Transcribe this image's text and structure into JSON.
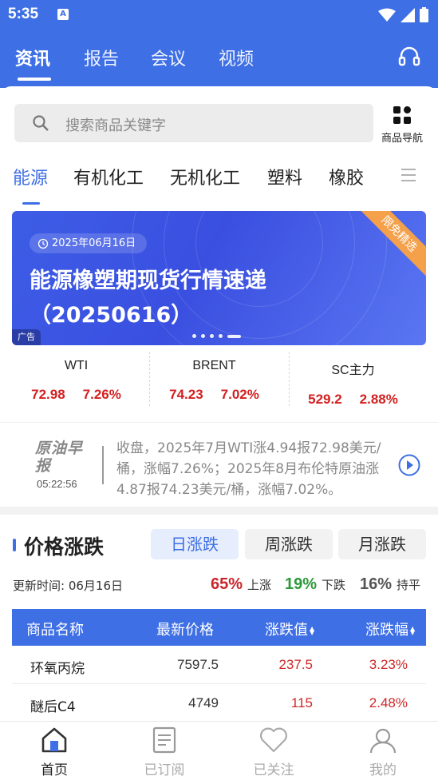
{
  "status_bar": {
    "time": "5:35"
  },
  "top_tabs": [
    {
      "label": "资讯",
      "active": true
    },
    {
      "label": "报告",
      "active": false
    },
    {
      "label": "会议",
      "active": false
    },
    {
      "label": "视频",
      "active": false
    }
  ],
  "search": {
    "placeholder": "搜索商品关键字",
    "goods_nav_label": "商品导航"
  },
  "category_tabs": [
    {
      "label": "能源",
      "active": true
    },
    {
      "label": "有机化工",
      "active": false
    },
    {
      "label": "无机化工",
      "active": false
    },
    {
      "label": "塑料",
      "active": false
    },
    {
      "label": "橡胶",
      "active": false
    }
  ],
  "banner": {
    "date": "2025年06月16日",
    "title": "能源橡塑期现货行情速递（20250616）",
    "ribbon": "限免精选",
    "ad_label": "广告",
    "dot_count": 5,
    "active_dot": 4
  },
  "quotes": [
    {
      "name": "WTI",
      "price": "72.98",
      "change": "7.26%"
    },
    {
      "name": "BRENT",
      "price": "74.23",
      "change": "7.02%"
    },
    {
      "name": "SC主力",
      "price": "529.2",
      "change": "2.88%"
    }
  ],
  "morning_report": {
    "logo": "原油早报",
    "time": "05:22:56",
    "text": "收盘，2025年7月WTI涨4.94报72.98美元/桶，涨幅7.26%；2025年8月布伦特原油涨4.87报74.23美元/桶，涨幅7.02%。"
  },
  "price_section": {
    "title": "价格涨跌",
    "period_tabs": [
      {
        "label": "日涨跌",
        "active": true
      },
      {
        "label": "周涨跌",
        "active": false
      },
      {
        "label": "月涨跌",
        "active": false
      }
    ],
    "update_time": "更新时间: 06月16日",
    "stats": {
      "up_pct": "65%",
      "up_label": "上涨",
      "down_pct": "19%",
      "down_label": "下跌",
      "flat_pct": "16%",
      "flat_label": "持平"
    },
    "columns": [
      "商品名称",
      "最新价格",
      "涨跌值",
      "涨跌幅"
    ],
    "rows": [
      {
        "name": "环氧丙烷",
        "price": "7597.5",
        "change": "237.5",
        "pct": "3.23%"
      },
      {
        "name": "醚后C4",
        "price": "4749",
        "change": "115",
        "pct": "2.48%"
      }
    ]
  },
  "bottom_nav": [
    {
      "label": "首页",
      "icon": "home-icon",
      "active": true
    },
    {
      "label": "已订阅",
      "icon": "document-icon",
      "active": false
    },
    {
      "label": "已关注",
      "icon": "heart-icon",
      "active": false
    },
    {
      "label": "我的",
      "icon": "user-icon",
      "active": false
    }
  ],
  "colors": {
    "primary": "#3e6fe4",
    "up": "#c9252b",
    "down": "#2c9a3a",
    "ribbon": "#f5a04a"
  }
}
